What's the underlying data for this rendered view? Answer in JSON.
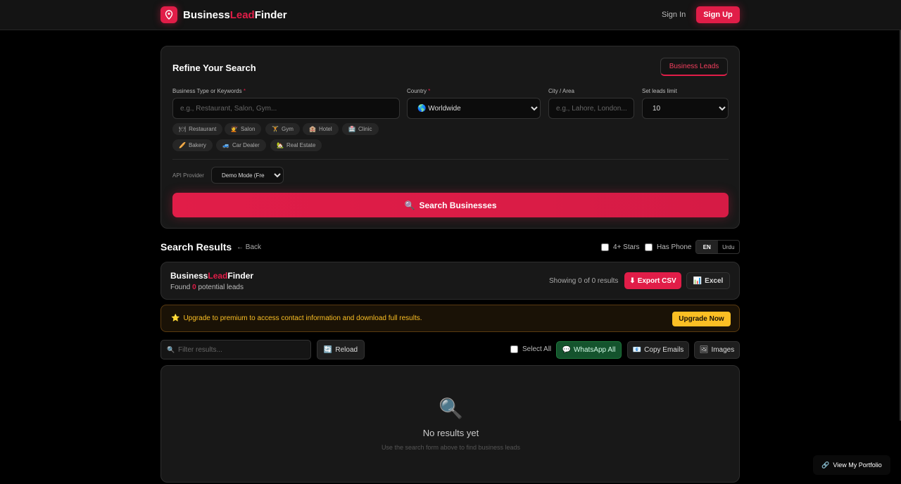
{
  "header": {
    "brand_part1": "Business",
    "brand_part2": "Lead",
    "brand_part3": "Finder",
    "signin_label": "Sign In",
    "signup_label": "Sign Up"
  },
  "refine": {
    "title": "Refine Your Search",
    "leads_tab": "Business Leads",
    "business_type_label": "Business Type or Keywords",
    "business_type_placeholder": "e.g., Restaurant, Salon, Gym...",
    "country_label": "Country",
    "country_value": "🌎 Worldwide",
    "city_label": "City / Area",
    "city_placeholder": "e.g., Lahore, London...",
    "limit_label": "Set leads limit",
    "limit_value": "10",
    "required_mark": "*",
    "chips": [
      {
        "icon": "🍽",
        "label": "Restaurant"
      },
      {
        "icon": "💇",
        "label": "Salon"
      },
      {
        "icon": "🏋",
        "label": "Gym"
      },
      {
        "icon": "🏨",
        "label": "Hotel"
      },
      {
        "icon": "🏥",
        "label": "Clinic"
      },
      {
        "icon": "🥖",
        "label": "Bakery"
      },
      {
        "icon": "🚙",
        "label": "Car Dealer"
      },
      {
        "icon": "🏡",
        "label": "Real Estate"
      }
    ],
    "api_label": "API Provider",
    "api_value": "Demo Mode (Free)",
    "search_icon": "🔍",
    "search_label": "Search Businesses"
  },
  "results": {
    "title": "Search Results",
    "back_label": "← Back",
    "filter_stars": "4+ Stars",
    "filter_phone": "Has Phone",
    "lang_en": "EN",
    "lang_urdu": "Urdu",
    "found_prefix": "Found",
    "found_count": "0",
    "found_suffix": "potential leads",
    "showing": "Showing 0 of 0 results",
    "export_csv_icon": "⬇",
    "export_csv": "Export CSV",
    "excel_icon": "📊",
    "excel": "Excel"
  },
  "upgrade": {
    "icon": "⭐",
    "text": "Upgrade to premium to access contact information and download full results.",
    "button": "Upgrade Now"
  },
  "toolbar": {
    "filter_icon": "🔍",
    "filter_placeholder": "Filter results...",
    "reload_icon": "🔄",
    "reload": "Reload",
    "select_all": "Select All",
    "whatsapp_icon": "💬",
    "whatsapp": "WhatsApp All",
    "copy_icon": "📧",
    "copy_emails": "Copy Emails",
    "images_icon": "🖼",
    "images": "Images"
  },
  "empty": {
    "icon": "🔍",
    "title": "No results yet",
    "subtitle": "Use the search form above to find business leads"
  },
  "portfolio": {
    "icon": "🔗",
    "label": "View My Portfolio"
  },
  "colors": {
    "accent": "#e11d48",
    "warning": "#fbbf24",
    "success": "#14532d"
  }
}
